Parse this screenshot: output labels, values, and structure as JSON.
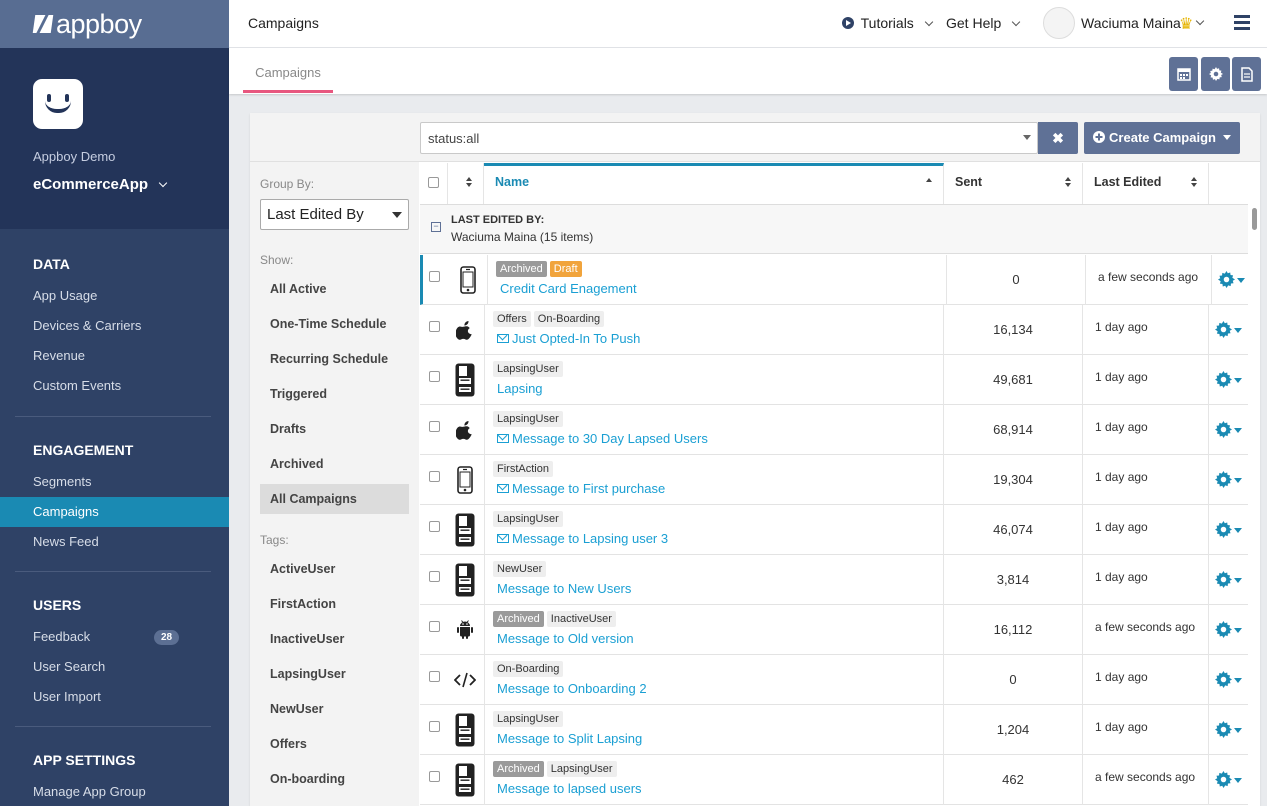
{
  "brand": {
    "logo_text": "appboy",
    "accent": "#1a8ab3",
    "sidebar_bg": "#2f4266"
  },
  "app": {
    "org": "Appboy Demo",
    "name": "eCommerceApp"
  },
  "sidebar": {
    "sections": [
      {
        "heading": "DATA",
        "items": [
          {
            "label": "App Usage"
          },
          {
            "label": "Devices & Carriers"
          },
          {
            "label": "Revenue"
          },
          {
            "label": "Custom Events"
          }
        ]
      },
      {
        "heading": "ENGAGEMENT",
        "items": [
          {
            "label": "Segments"
          },
          {
            "label": "Campaigns",
            "active": true
          },
          {
            "label": "News Feed"
          }
        ]
      },
      {
        "heading": "USERS",
        "items": [
          {
            "label": "Feedback",
            "badge": "28"
          },
          {
            "label": "User Search"
          },
          {
            "label": "User Import"
          }
        ]
      },
      {
        "heading": "APP SETTINGS",
        "items": [
          {
            "label": "Manage App Group"
          }
        ]
      }
    ]
  },
  "topbar": {
    "title": "Campaigns",
    "tutorials": "Tutorials",
    "help": "Get Help",
    "user_name": "Waciuma Maina"
  },
  "tabs": {
    "active": "Campaigns"
  },
  "toolbar_icons": [
    "calendar-icon",
    "gear-icon",
    "document-icon"
  ],
  "filter": {
    "search_value": "status:all",
    "create_label": "Create Campaign"
  },
  "left_panel": {
    "group_by_label": "Group By:",
    "group_by_value": "Last Edited By",
    "show_label": "Show:",
    "show_items": [
      "All Active",
      "One-Time Schedule",
      "Recurring Schedule",
      "Triggered",
      "Drafts",
      "Archived",
      "All Campaigns"
    ],
    "selected_show": "All Campaigns",
    "tags_label": "Tags:",
    "tag_items": [
      "ActiveUser",
      "FirstAction",
      "InactiveUser",
      "LapsingUser",
      "NewUser",
      "Offers",
      "On-boarding"
    ]
  },
  "table": {
    "columns": {
      "name": "Name",
      "sent": "Sent",
      "last_edited": "Last Edited"
    },
    "group": {
      "title": "LAST EDITED BY:",
      "subtitle": "Waciuma Maina (15 items)"
    },
    "rows": [
      {
        "platform": "phone",
        "tags": [
          {
            "t": "Archived",
            "k": "archived"
          },
          {
            "t": "Draft",
            "k": "draft"
          }
        ],
        "email": false,
        "name": "Credit Card Enagement",
        "sent": "0",
        "edited": "a few seconds ago"
      },
      {
        "platform": "apple",
        "tags": [
          {
            "t": "Offers"
          },
          {
            "t": "On-Boarding"
          }
        ],
        "email": true,
        "name": "Just Opted-In To Push",
        "sent": "16,134",
        "edited": "1 day ago"
      },
      {
        "platform": "multi",
        "tags": [
          {
            "t": "LapsingUser"
          }
        ],
        "email": false,
        "name": "Lapsing",
        "sent": "49,681",
        "edited": "1 day ago"
      },
      {
        "platform": "apple",
        "tags": [
          {
            "t": "LapsingUser"
          }
        ],
        "email": true,
        "name": "Message to 30 Day Lapsed Users",
        "sent": "68,914",
        "edited": "1 day ago"
      },
      {
        "platform": "phone",
        "tags": [
          {
            "t": "FirstAction"
          }
        ],
        "email": true,
        "name": "Message to First purchase",
        "sent": "19,304",
        "edited": "1 day ago"
      },
      {
        "platform": "multi",
        "tags": [
          {
            "t": "LapsingUser"
          }
        ],
        "email": true,
        "name": "Message to Lapsing user 3",
        "sent": "46,074",
        "edited": "1 day ago"
      },
      {
        "platform": "multi",
        "tags": [
          {
            "t": "NewUser"
          }
        ],
        "email": false,
        "name": "Message to New Users",
        "sent": "3,814",
        "edited": "1 day ago"
      },
      {
        "platform": "android",
        "tags": [
          {
            "t": "Archived",
            "k": "archived"
          },
          {
            "t": "InactiveUser"
          }
        ],
        "email": false,
        "name": "Message to Old version",
        "sent": "16,112",
        "edited": "a few seconds ago"
      },
      {
        "platform": "code",
        "tags": [
          {
            "t": "On-Boarding"
          }
        ],
        "email": false,
        "name": "Message to Onboarding 2",
        "sent": "0",
        "edited": "1 day ago"
      },
      {
        "platform": "multi",
        "tags": [
          {
            "t": "LapsingUser"
          }
        ],
        "email": false,
        "name": "Message to Split Lapsing",
        "sent": "1,204",
        "edited": "1 day ago"
      },
      {
        "platform": "multi",
        "tags": [
          {
            "t": "Archived",
            "k": "archived"
          },
          {
            "t": "LapsingUser"
          }
        ],
        "email": false,
        "name": "Message to lapsed users",
        "sent": "462",
        "edited": "a few seconds ago"
      }
    ]
  }
}
